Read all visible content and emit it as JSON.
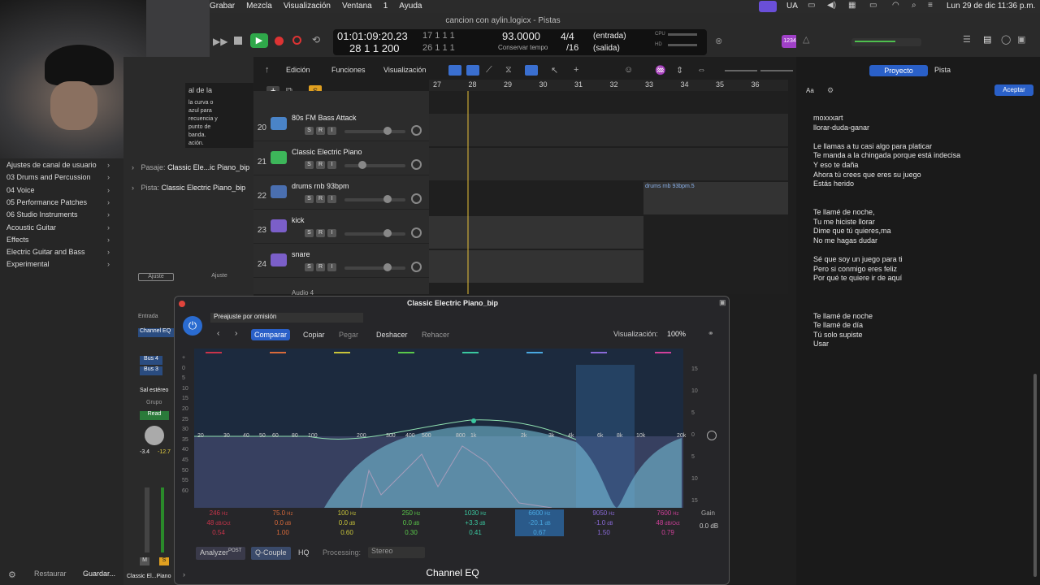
{
  "menubar": {
    "items": [
      "Grabar",
      "Mezcla",
      "Visualización",
      "Ventana",
      "1",
      "Ayuda"
    ],
    "lang": "UA",
    "datetime": "Lun 29 de dic 11:36 p.m."
  },
  "window": {
    "title": "cancion con aylin.logicx - Pistas"
  },
  "transport": {
    "time": "01:01:09:20.23",
    "bars": "28 1 1 200",
    "beat1": "17 1 1 1",
    "beat2": "26 1 1 1",
    "tempo": "93.0000",
    "tempo_label": "Conservar tempo",
    "sig": "4/4",
    "div": "/16",
    "in": "(entrada)",
    "out": "(salida)",
    "cpu": "CPU",
    "hd": "HD",
    "counter": "1234"
  },
  "right_tabs": {
    "project": "Proyecto",
    "track": "Pista",
    "font": "Aa",
    "accept": "Aceptar"
  },
  "toolbar": {
    "edit": "Edición",
    "functions": "Funciones",
    "view": "Visualización"
  },
  "ruler": [
    "27",
    "28",
    "29",
    "30",
    "31",
    "32",
    "33",
    "34",
    "35",
    "36"
  ],
  "tracks": [
    {
      "num": "20",
      "name": "80s FM Bass Attack",
      "color": "#4a84c8"
    },
    {
      "num": "21",
      "name": "Classic Electric Piano",
      "color": "#3db65a"
    },
    {
      "num": "22",
      "name": "drums rnb 93bpm",
      "color": "#4a6fb0"
    },
    {
      "num": "23",
      "name": "kick",
      "color": "#7b5fc9"
    },
    {
      "num": "24",
      "name": "snare",
      "color": "#7b5fc9"
    }
  ],
  "hidden_track": "Audio 4",
  "region": {
    "drums": "drums rnb 93bpm.5"
  },
  "inspector": {
    "pasaje_label": "Pasaje:",
    "pasaje": "Classic Ele...ic Piano_bip",
    "pista_label": "Pista:",
    "pista": "Classic Electric Piano_bip",
    "ajuste": "Ajuste",
    "entrada": "Entrada",
    "eq": "Channel EQ",
    "bus4": "Bus 4",
    "bus3": "Bus 3",
    "sal": "Sal estéreo",
    "grupo": "Grupo",
    "read": "Read",
    "vol1": "-3.4",
    "vol2": "-12.7",
    "strip": "Classic El...Piano"
  },
  "info_text": {
    "t1": "al de la",
    "t2": "la curva o",
    "t3": "azul para",
    "t4": "recuencia y",
    "t5": "punto de",
    "t6": "banda.",
    "t7": "ación."
  },
  "library": [
    "Ajustes de canal de usuario",
    "03 Drums and Percussion",
    "04 Voice",
    "05 Performance Patches",
    "06 Studio Instruments",
    "Acoustic Guitar",
    "Effects",
    "Electric Guitar and Bass",
    "Experimental"
  ],
  "bottom_left": {
    "restore": "Restaurar",
    "save": "Guardar..."
  },
  "lyrics": [
    "moxxxart",
    "llorar-duda-ganar",
    "",
    "Le llamas a tu casi algo para platicar",
    "Te manda a la chingada porque está indecisa",
    "Y eso te daña",
    "Ahora tú crees que eres su juego",
    "Estás herido",
    "",
    "",
    "Te llamé de noche,",
    "Tu me hiciste llorar",
    "Dime que tú quieres,ma",
    "No me hagas dudar",
    "",
    "Sé que soy un juego para ti",
    "Pero si conmigo eres feliz",
    "Por qué te quiere ir de aquí",
    "",
    "",
    "",
    "Te llamé de noche",
    "Te llamé de día",
    "Tú solo supiste",
    "Usar"
  ],
  "plugin": {
    "title": "Classic Electric Piano_bip",
    "preset": "Preajuste por omisión",
    "compare": "Comparar",
    "copy": "Copiar",
    "paste": "Pegar",
    "undo": "Deshacer",
    "redo": "Rehacer",
    "view_label": "Visualización:",
    "view": "100%",
    "analyzer": "Analyzer",
    "post": "POST",
    "qcouple": "Q-Couple",
    "hq": "HQ",
    "processing": "Processing:",
    "stereo": "Stereo",
    "name": "Channel EQ",
    "gain": "Gain",
    "gain_val": "0.0 dB",
    "freq_labels": [
      "20",
      "30",
      "40",
      "50",
      "60",
      "80",
      "100",
      "200",
      "300",
      "400",
      "500",
      "800",
      "1k",
      "2k",
      "3k",
      "4k",
      "6k",
      "8k",
      "10k",
      "20k"
    ],
    "db_left": [
      "+",
      "0",
      "5",
      "10",
      "15",
      "20",
      "25",
      "30",
      "35",
      "40",
      "45",
      "50",
      "55",
      "60"
    ],
    "db_right": [
      "15",
      "10",
      "5",
      "0",
      "5",
      "10",
      "15"
    ],
    "bands": [
      {
        "f": "246",
        "fu": "Hz",
        "g": "48",
        "gu": "dB/Oct",
        "q": "0.54",
        "c": "#c8344a"
      },
      {
        "f": "75.0",
        "fu": "Hz",
        "g": "0.0",
        "gu": "dB",
        "q": "1.00",
        "c": "#d86a3a"
      },
      {
        "f": "100",
        "fu": "Hz",
        "g": "0.0",
        "gu": "dB",
        "q": "0.60",
        "c": "#c8c43a"
      },
      {
        "f": "250",
        "fu": "Hz",
        "g": "0.0",
        "gu": "dB",
        "q": "0.30",
        "c": "#5ac84a"
      },
      {
        "f": "1030",
        "fu": "Hz",
        "g": "+3.3",
        "gu": "dB",
        "q": "0.41",
        "c": "#3ac8a0"
      },
      {
        "f": "6600",
        "fu": "Hz",
        "g": "-20.1",
        "gu": "dB",
        "q": "0.67",
        "c": "#4aa8e0"
      },
      {
        "f": "9050",
        "fu": "Hz",
        "g": "-1.0",
        "gu": "dB",
        "q": "1.50",
        "c": "#8a6ad8"
      },
      {
        "f": "7600",
        "fu": "Hz",
        "g": "48",
        "gu": "dB/Oct",
        "q": "0.79",
        "c": "#d0409a"
      }
    ]
  }
}
